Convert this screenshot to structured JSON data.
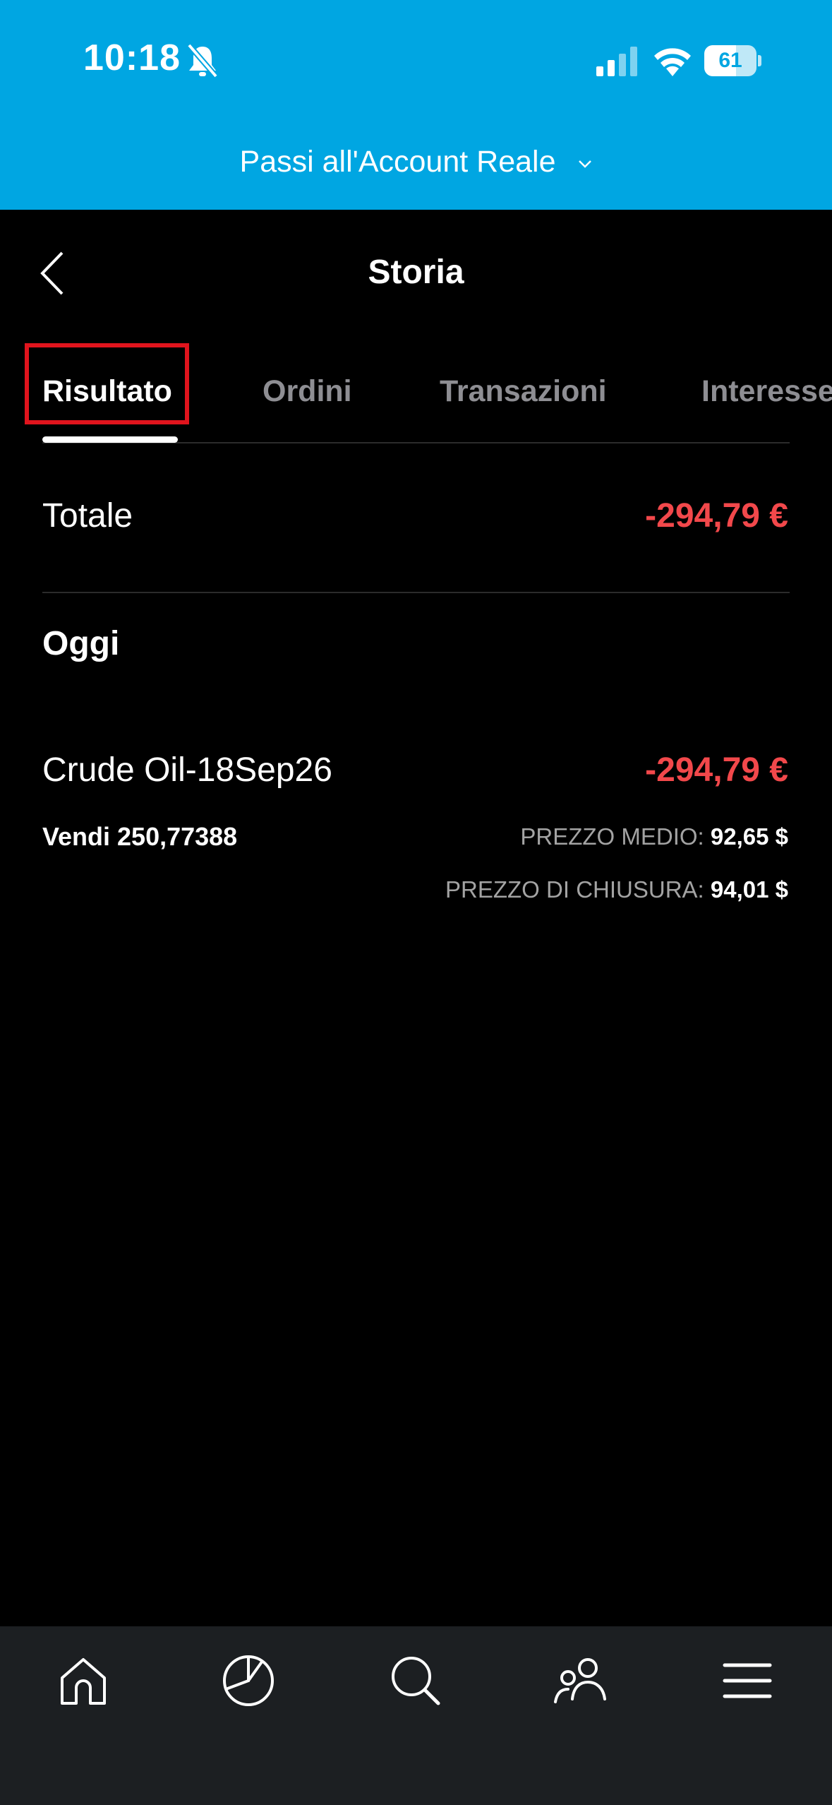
{
  "status_bar": {
    "time": "10:18",
    "battery_percent": "61",
    "battery_level": 0.61
  },
  "banner": {
    "account_switch_label": "Passi all'Account Reale"
  },
  "header": {
    "title": "Storia"
  },
  "tabs": [
    {
      "label": "Risultato",
      "active": true
    },
    {
      "label": "Ordini",
      "active": false
    },
    {
      "label": "Transazioni",
      "active": false
    },
    {
      "label": "Interesse",
      "active": false
    }
  ],
  "summary": {
    "total_label": "Totale",
    "total_value": "-294,79 €"
  },
  "section": {
    "title": "Oggi"
  },
  "trade": {
    "instrument": "Crude Oil-18Sep26",
    "pnl": "-294,79 €",
    "side": "Vendi 250,77388",
    "avg_price_label": "PREZZO MEDIO:",
    "avg_price_value": "92,65 $",
    "close_price_label": "PREZZO DI CHIUSURA:",
    "close_price_value": "94,01 $"
  },
  "bottom_nav": [
    "home-icon",
    "portfolio-pie-icon",
    "search-icon",
    "social-icon",
    "menu-icon"
  ],
  "colors": {
    "banner": "#00a6e2",
    "negative": "#f2484b",
    "highlight": "#e0141d",
    "background": "#000000",
    "nav_background": "#1c1f22"
  }
}
